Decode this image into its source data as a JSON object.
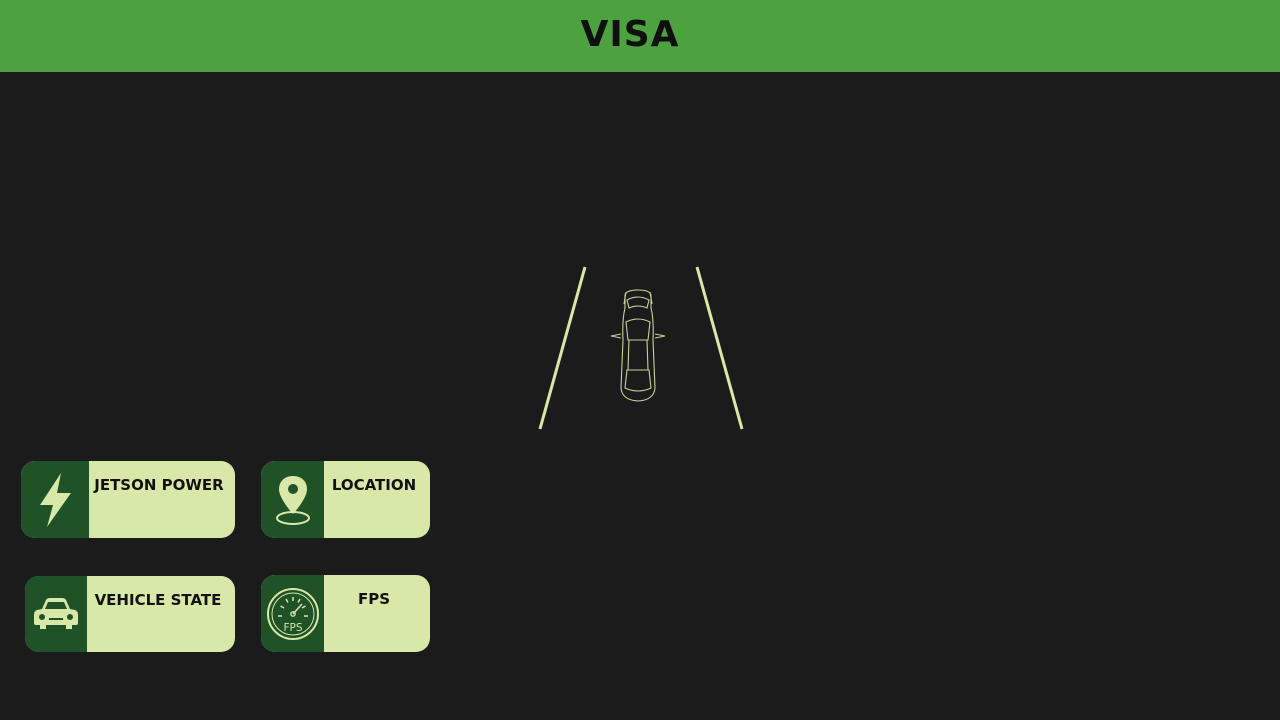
{
  "header": {
    "title": "VISA",
    "background_color": "#4ca23e"
  },
  "theme": {
    "panel_color": "#d8e8a8",
    "icon_bg": "#1f5227",
    "background": "#1b1b1b"
  },
  "cards": [
    {
      "label": "JETSON POWER",
      "value": "",
      "icon": "lightning-bolt-icon"
    },
    {
      "label": "LOCATION",
      "value": "",
      "icon": "location-pin-icon"
    },
    {
      "label": "VEHICLE STATE",
      "value": "",
      "icon": "car-front-icon"
    },
    {
      "label": "FPS",
      "value": "",
      "icon": "speedometer-fps-icon",
      "icon_text": "FPS"
    }
  ]
}
